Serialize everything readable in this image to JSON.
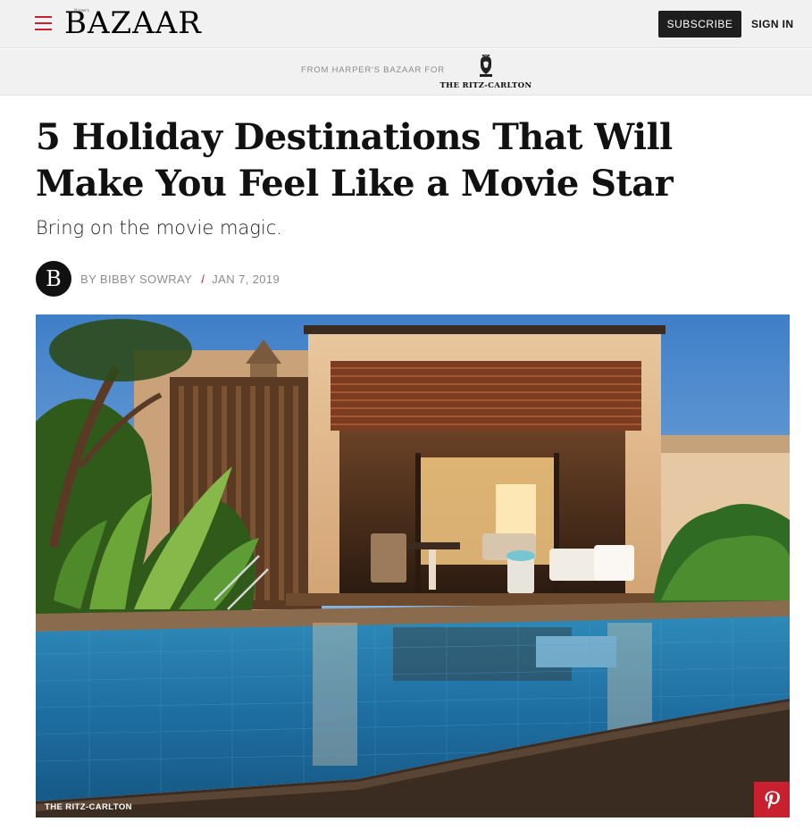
{
  "header": {
    "logo_text": "BAZAAR",
    "logo_sup": "Harper's",
    "subscribe_label": "SUBSCRIBE",
    "signin_label": "SIGN IN"
  },
  "sponsor": {
    "from_label": "FROM HARPER'S BAZAAR FOR",
    "brand_name": "THE RITZ-CARLTON"
  },
  "article": {
    "title": "5 Holiday Destinations That Will Make You Feel Like a Movie Star",
    "dek": "Bring on the movie magic.",
    "avatar_letter": "B",
    "author": "BY BIBBY SOWRAY",
    "separator": "/",
    "date": "JAN 7, 2019",
    "image_credit": "THE RITZ-CARLTON"
  },
  "colors": {
    "accent": "#c8202f",
    "header_bg": "#f1f1f1",
    "button_dark": "#1e1e1e"
  },
  "icons": {
    "menu": "hamburger-icon",
    "pin": "pinterest-icon",
    "crest": "lion-crest-icon"
  }
}
